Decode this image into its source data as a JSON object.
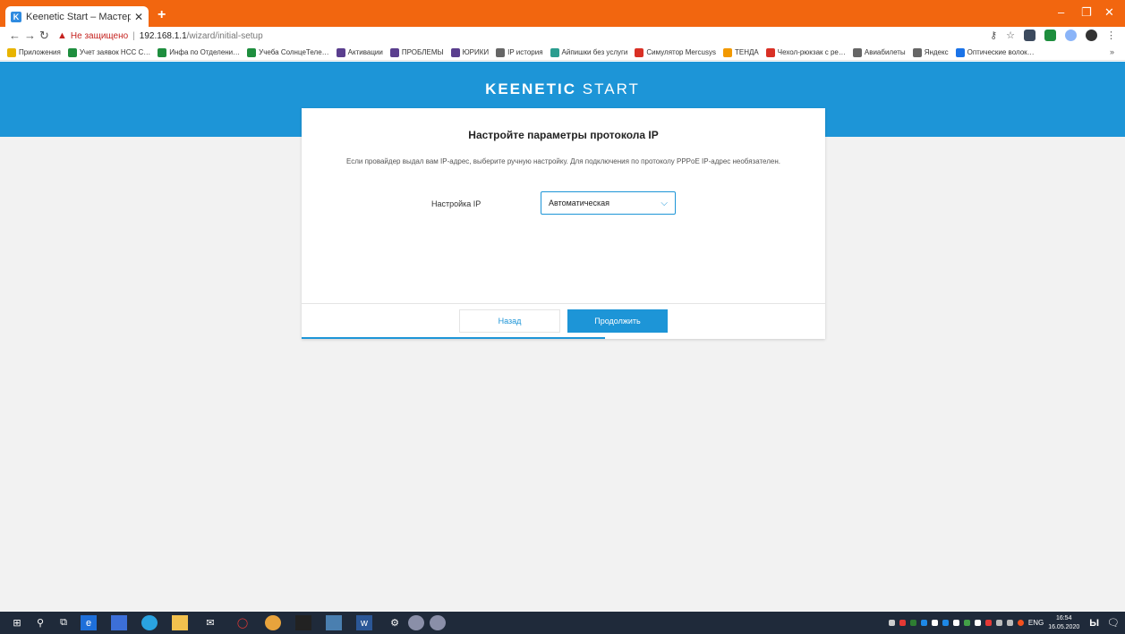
{
  "browser": {
    "tab_title": "Keenetic Start – Мастер быстро…",
    "tab_favicon": "K",
    "new_tab": "+",
    "window_controls": [
      "–",
      "❐",
      "✕"
    ],
    "address": {
      "not_secure": "Не защищено",
      "host": "192.168.1.1",
      "path": "/wizard/initial-setup"
    },
    "bookmarks": [
      {
        "label": "Приложения",
        "color": "#e8b400"
      },
      {
        "label": "Учет заявок НСС С…",
        "color": "#1e8e3e"
      },
      {
        "label": "Инфа по Отделени…",
        "color": "#1e8e3e"
      },
      {
        "label": "Учеба СолнцеТеле…",
        "color": "#1e8e3e"
      },
      {
        "label": "Активации",
        "color": "#5a3e8e"
      },
      {
        "label": "ПРОБЛЕМЫ",
        "color": "#5a3e8e"
      },
      {
        "label": "ЮРИКИ",
        "color": "#5a3e8e"
      },
      {
        "label": "IP история",
        "color": "#666666"
      },
      {
        "label": "Айпишки без услуги",
        "color": "#2a9d8f"
      },
      {
        "label": "Симулятор Mercusys",
        "color": "#d93025"
      },
      {
        "label": "ТЕНДА",
        "color": "#f29900"
      },
      {
        "label": "Чехол-рюкзак с ре…",
        "color": "#d93025"
      },
      {
        "label": "Авиабилеты",
        "color": "#666666"
      },
      {
        "label": "Яндекс",
        "color": "#666666"
      },
      {
        "label": "Оптические волок…",
        "color": "#1a73e8"
      }
    ],
    "bookmarks_more": "»"
  },
  "page": {
    "brand_bold": "KEENETIC",
    "brand_light": "START",
    "title": "Настройте параметры протокола IP",
    "description": "Если провайдер выдал вам IP-адрес, выберите ручную настройку. Для подключения по протоколу PPPoE IP-адрес необязателен.",
    "ip_field": {
      "label": "Настройка IP",
      "value": "Автоматическая"
    },
    "back_label": "Назад",
    "next_label": "Продолжить",
    "progress": 0.58,
    "accent_color": "#1d95d7"
  },
  "taskbar": {
    "language": "ENG",
    "time": "16:54",
    "date": "16.05.2020"
  }
}
